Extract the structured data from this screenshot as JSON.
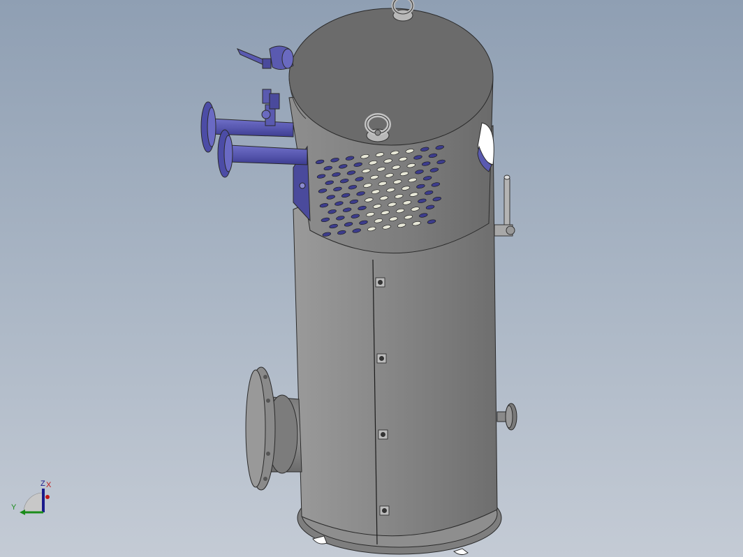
{
  "viewport": {
    "background_top": "#8f9fb3",
    "background_bottom": "#c4cbd5"
  },
  "model": {
    "body_color": "#8a8a8a",
    "fitting_color": "#5a5ab0"
  },
  "triad": {
    "z_label": "Z",
    "x_label": "X",
    "y_label": "Y",
    "z_color": "#1a1a8c",
    "x_color": "#c01818",
    "y_color": "#1a8c1a"
  }
}
